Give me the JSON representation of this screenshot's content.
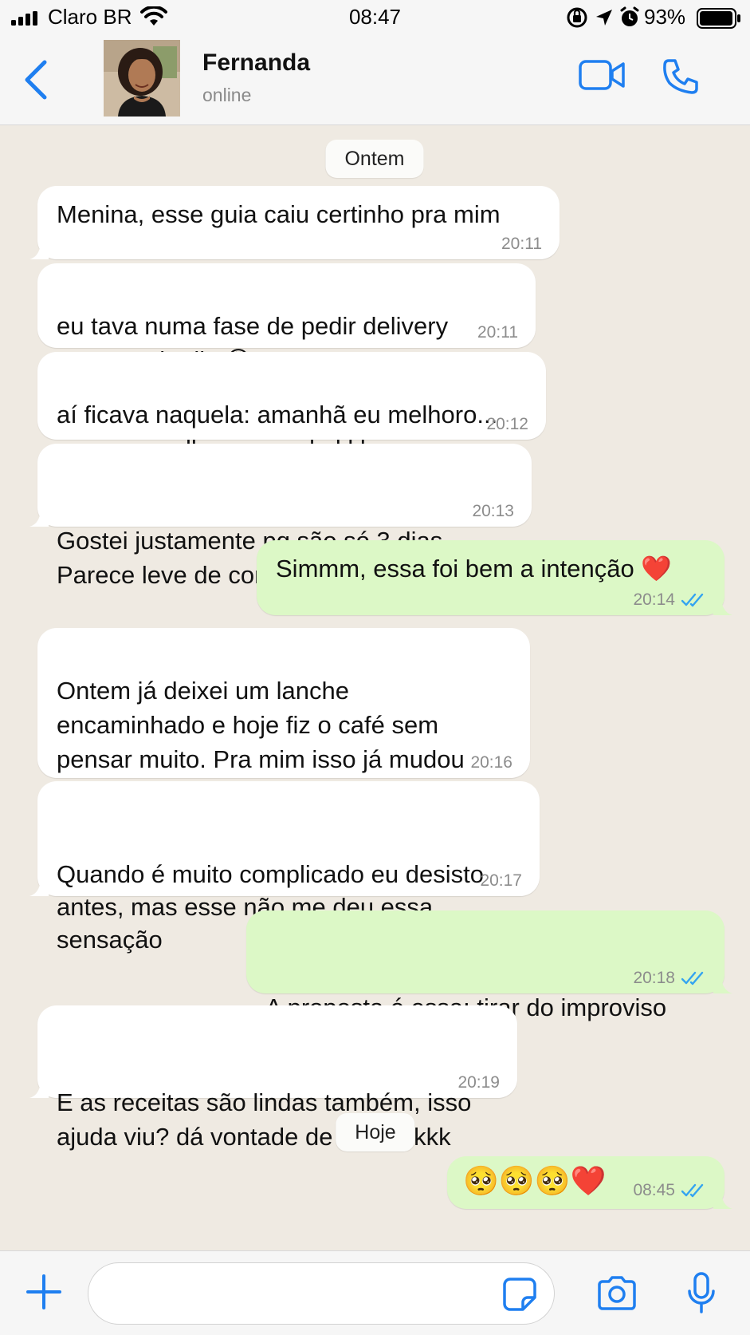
{
  "status_bar": {
    "carrier": "Claro BR",
    "time": "08:47",
    "battery": "93%"
  },
  "header": {
    "back_icon": "chevron-left-icon",
    "contact_name": "Fernanda",
    "contact_status": "online",
    "video_icon": "video-camera-icon",
    "call_icon": "phone-icon",
    "accent_color": "#1f7ff0"
  },
  "chat": {
    "day_labels": [
      "Ontem",
      "Hoje"
    ],
    "messages": [
      {
        "dir": "in",
        "text": "Menina, esse guia caiu certinho pra mim",
        "time": "20:11"
      },
      {
        "dir": "in",
        "text": "eu tava numa fase de pedir delivery\nquase todo dia 😩",
        "time": "20:11"
      },
      {
        "dir": "in",
        "text": "aí ficava naquela: amanhã eu melhoro...\ne nunca melhorava nada kkk",
        "time": "20:12"
      },
      {
        "dir": "in",
        "text": "Gostei justamente pq são só 3 dias.\nParece leve de começar, sabe?",
        "time": "20:13"
      },
      {
        "dir": "out",
        "text": "Simmm, essa foi bem a intenção ❤️",
        "time": "20:14",
        "read": true
      },
      {
        "dir": "in",
        "text": "Ontem já deixei um lanche\nencaminhado e hoje fiz o café sem\npensar muito. Pra mim isso já mudou\ntudo",
        "time": "20:16"
      },
      {
        "dir": "in",
        "text": "Quando é muito complicado eu desisto\nantes, mas esse não me deu essa\nsensação",
        "time": "20:17"
      },
      {
        "dir": "out",
        "text": "A proposta é essa: tirar do improviso\nsem virar peso",
        "time": "20:18",
        "read": true
      },
      {
        "dir": "in",
        "text": "E as receitas são lindas também, isso\najuda viu? dá vontade de seguir kkk",
        "time": "20:19"
      },
      {
        "dir": "out",
        "text": "🥺🥺🥺❤️",
        "time": "08:45",
        "read": true
      }
    ],
    "colors": {
      "incoming": "#ffffff",
      "outgoing": "#dcf8c6",
      "read_ticks": "#34a4f0",
      "background": "#efeae2"
    }
  },
  "input_bar": {
    "plus_icon": "plus-icon",
    "message_value": "",
    "sticker_icon": "sticker-icon",
    "camera_icon": "camera-icon",
    "mic_icon": "microphone-icon"
  }
}
